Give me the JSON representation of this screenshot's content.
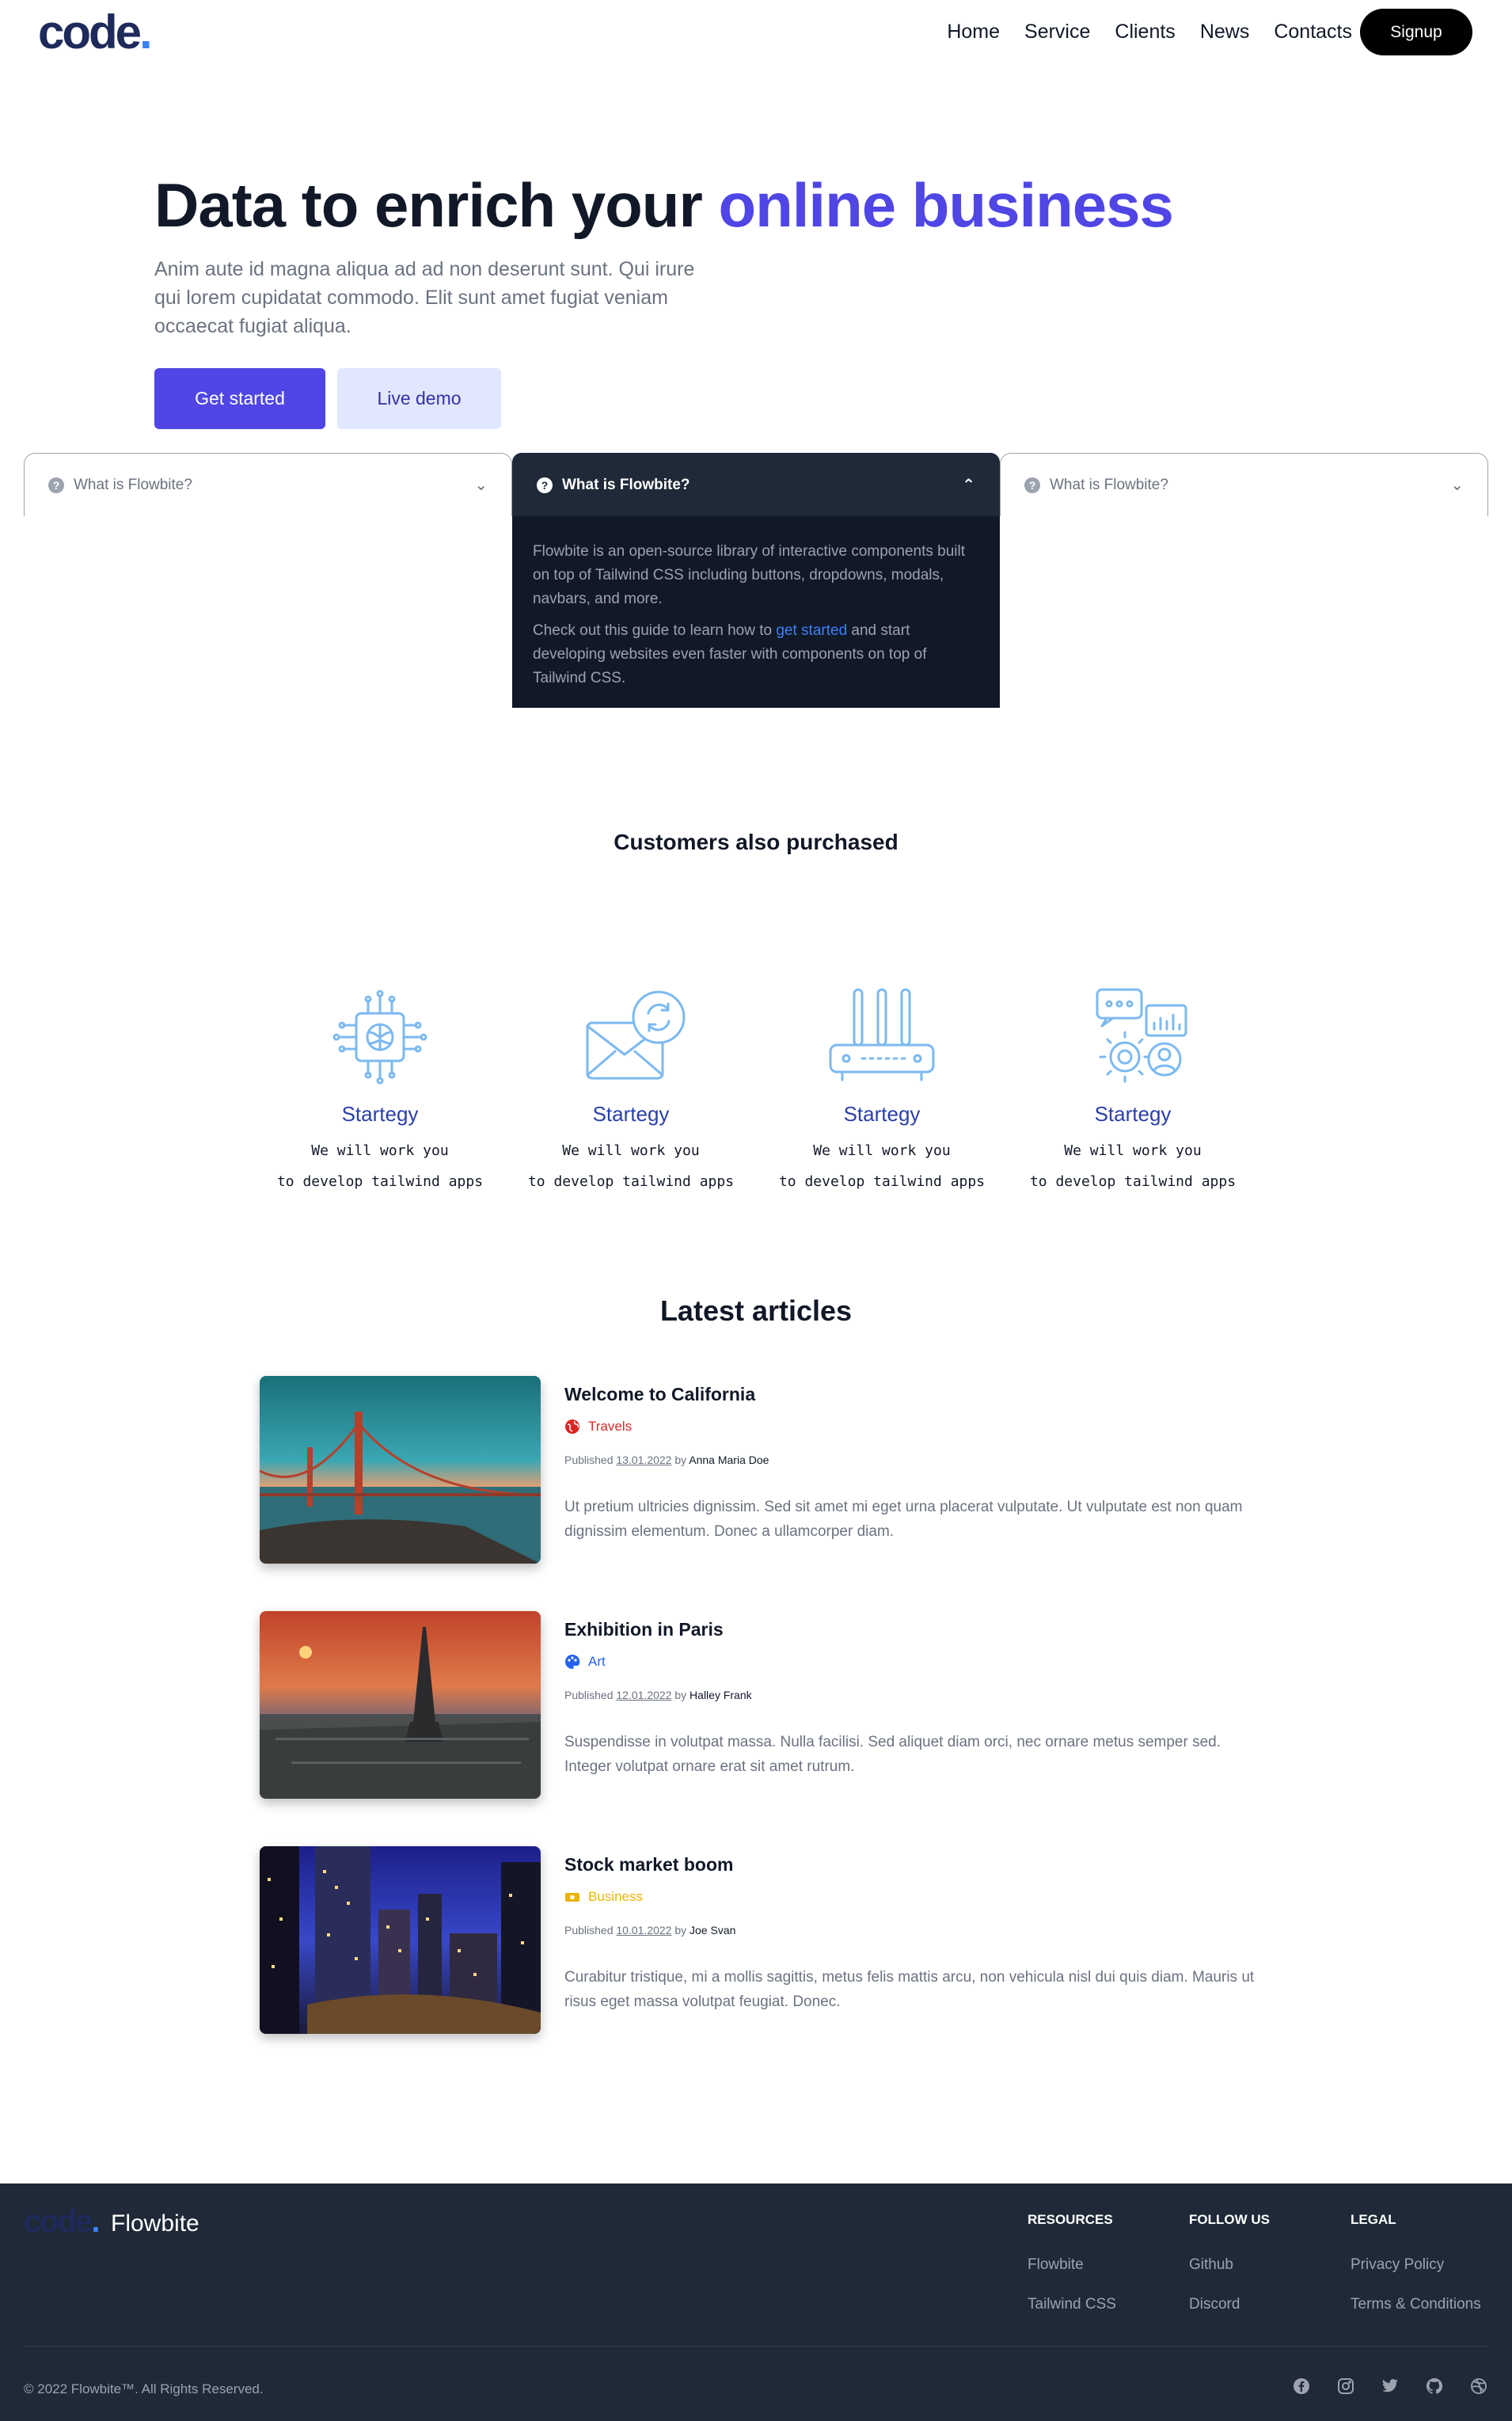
{
  "nav": {
    "logo_main": "code",
    "logo_dot": ".",
    "links": [
      "Home",
      "Service",
      "Clients",
      "News",
      "Contacts"
    ],
    "signup": "Signup"
  },
  "hero": {
    "title_main": "Data to enrich your ",
    "title_accent": "online business",
    "subtitle": "Anim aute id magna aliqua ad ad non deserunt sunt. Qui irure qui lorem cupidatat commodo. Elit sunt amet fugiat veniam occaecat fugiat aliqua.",
    "primary_button": "Get started",
    "secondary_button": "Live demo"
  },
  "accordion": {
    "items": [
      {
        "question": "What is Flowbite?",
        "expanded": false
      },
      {
        "question": "What is Flowbite?",
        "expanded": true
      },
      {
        "question": "What is Flowbite?",
        "expanded": false
      }
    ],
    "body_p1": "Flowbite is an open-source library of interactive components built on top of Tailwind CSS including buttons, dropdowns, modals, navbars, and more.",
    "body_p2_before": "Check out this guide to learn how to ",
    "body_p2_link": "get started",
    "body_p2_after": " and start developing websites even faster with components on top of Tailwind CSS."
  },
  "customers": {
    "title": "Customers also purchased",
    "cards": [
      {
        "icon": "chip-brain-icon",
        "name": "Startegy",
        "line1": "We will work you",
        "line2": "to develop tailwind apps"
      },
      {
        "icon": "mail-sync-icon",
        "name": "Startegy",
        "line1": "We will work you",
        "line2": "to develop tailwind apps"
      },
      {
        "icon": "router-icon",
        "name": "Startegy",
        "line1": "We will work you",
        "line2": "to develop tailwind apps"
      },
      {
        "icon": "gear-support-icon",
        "name": "Startegy",
        "line1": "We will work you",
        "line2": "to develop tailwind apps"
      }
    ]
  },
  "articles": {
    "title": "Latest articles",
    "items": [
      {
        "title": "Welcome to California",
        "category": "Travels",
        "category_color": "#dc2626",
        "category_icon": "globe-icon",
        "published": "Published ",
        "date": "13.01.2022",
        "by": " by ",
        "author": "Anna Maria Doe",
        "excerpt": "Ut pretium ultricies dignissim. Sed sit amet mi eget urna placerat vulputate. Ut vulputate est non quam dignissim elementum. Donec a ullamcorper diam."
      },
      {
        "title": "Exhibition in Paris",
        "category": "Art",
        "category_color": "#2563eb",
        "category_icon": "palette-icon",
        "published": "Published ",
        "date": "12.01.2022",
        "by": " by ",
        "author": "Halley Frank",
        "excerpt": "Suspendisse in volutpat massa. Nulla facilisi. Sed aliquet diam orci, nec ornare metus semper sed. Integer volutpat ornare erat sit amet rutrum."
      },
      {
        "title": "Stock market boom",
        "category": "Business",
        "category_color": "#eab308",
        "category_icon": "money-icon",
        "published": "Published ",
        "date": "10.01.2022",
        "by": " by ",
        "author": "Joe Svan",
        "excerpt": "Curabitur tristique, mi a mollis sagittis, metus felis mattis arcu, non vehicula nisl dui quis diam. Mauris ut risus eget massa volutpat feugiat. Donec."
      }
    ]
  },
  "footer": {
    "logo_main": "code",
    "logo_dot": ".",
    "brand": "Flowbite",
    "columns": [
      {
        "heading": "RESOURCES",
        "links": [
          "Flowbite",
          "Tailwind CSS"
        ]
      },
      {
        "heading": "FOLLOW US",
        "links": [
          "Github",
          "Discord"
        ]
      },
      {
        "heading": "LEGAL",
        "links": [
          "Privacy Policy",
          "Terms & Conditions"
        ]
      }
    ],
    "copyright": "© 2022 Flowbite™. All Rights Reserved.",
    "social": [
      "facebook-icon",
      "instagram-icon",
      "twitter-icon",
      "github-icon",
      "dribbble-icon"
    ]
  }
}
